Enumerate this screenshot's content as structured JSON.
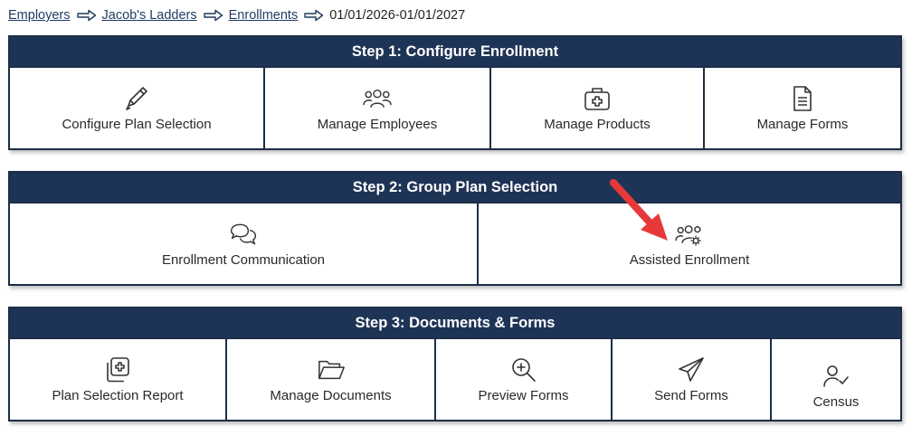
{
  "breadcrumb": {
    "items": [
      "Employers",
      "Jacob's Ladders",
      "Enrollments"
    ],
    "current": "01/01/2026-01/01/2027"
  },
  "steps": [
    {
      "title": "Step 1: Configure Enrollment",
      "tiles": [
        {
          "label": "Configure Plan Selection",
          "icon": "pencil-icon"
        },
        {
          "label": "Manage Employees",
          "icon": "users-icon"
        },
        {
          "label": "Manage Products",
          "icon": "medical-bag-icon"
        },
        {
          "label": "Manage Forms",
          "icon": "document-icon"
        }
      ]
    },
    {
      "title": "Step 2: Group Plan Selection",
      "tiles": [
        {
          "label": "Enrollment Communication",
          "icon": "chat-bubbles-icon"
        },
        {
          "label": "Assisted Enrollment",
          "icon": "users-gear-icon"
        }
      ]
    },
    {
      "title": "Step 3: Documents & Forms",
      "tiles": [
        {
          "label": "Plan Selection Report",
          "icon": "copy-plus-icon"
        },
        {
          "label": "Manage Documents",
          "icon": "folder-open-icon"
        },
        {
          "label": "Preview Forms",
          "icon": "zoom-in-icon"
        },
        {
          "label": "Send Forms",
          "icon": "paper-plane-icon"
        },
        {
          "label": "Census",
          "icon": "user-check-icon"
        }
      ]
    }
  ],
  "colors": {
    "header_bg": "#1e3456",
    "border": "#1c2d47",
    "annotation_arrow": "#e8393a"
  }
}
